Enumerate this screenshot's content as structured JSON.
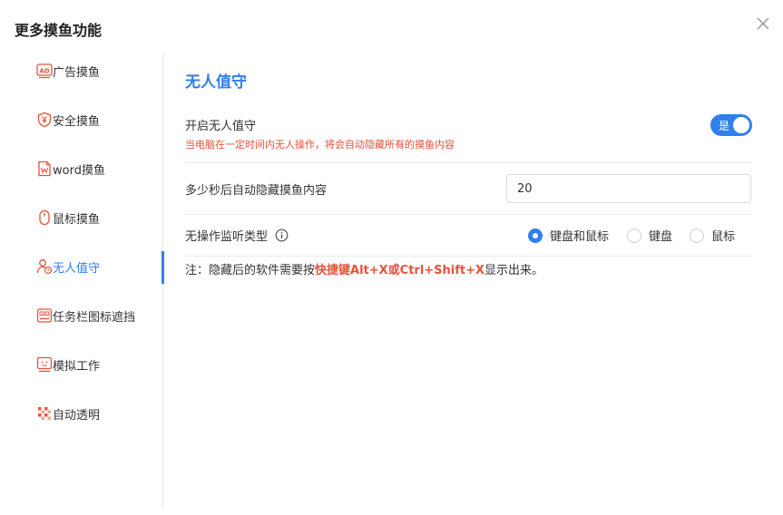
{
  "window": {
    "title": "更多摸鱼功能"
  },
  "sidebar": {
    "items": [
      {
        "label": "广告摸鱼",
        "icon": "ad-icon"
      },
      {
        "label": "安全摸鱼",
        "icon": "shield-yen-icon"
      },
      {
        "label": "word摸鱼",
        "icon": "word-doc-icon"
      },
      {
        "label": "鼠标摸鱼",
        "icon": "mouse-icon"
      },
      {
        "label": "无人值守",
        "icon": "user-clock-icon",
        "active": true
      },
      {
        "label": "任务栏图标遮挡",
        "icon": "taskbar-icon"
      },
      {
        "label": "模拟工作",
        "icon": "monitor-face-icon"
      },
      {
        "label": "自动透明",
        "icon": "transparent-icon"
      }
    ]
  },
  "main": {
    "section_title": "无人值守",
    "enable": {
      "label": "开启无人值守",
      "description": "当电脑在一定时间内无人操作，将会自动隐藏所有的摸鱼内容",
      "toggle_label": "是",
      "on": true
    },
    "timeout": {
      "label": "多少秒后自动隐藏摸鱼内容",
      "value": "20"
    },
    "monitor_type": {
      "label": "无操作监听类型",
      "options": [
        {
          "label": "键盘和鼠标",
          "checked": true
        },
        {
          "label": "键盘",
          "checked": false
        },
        {
          "label": "鼠标",
          "checked": false
        }
      ]
    },
    "note": {
      "prefix": "注：隐藏后的软件需要按",
      "highlight": "快捷键Alt+X或Ctrl+Shift+X",
      "suffix": "显示出来。"
    }
  },
  "colors": {
    "accent": "#2f80ed",
    "danger": "#e8513b"
  }
}
